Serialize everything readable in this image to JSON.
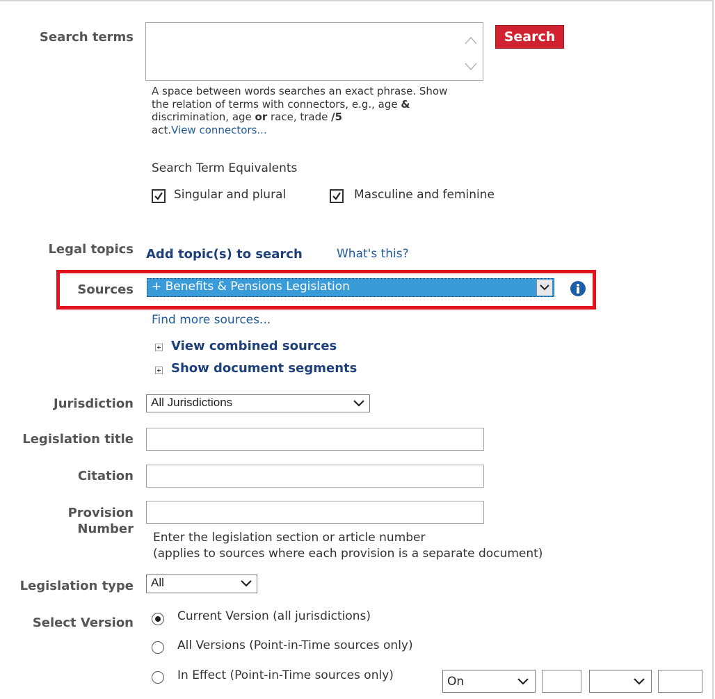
{
  "search_terms": {
    "label": "Search terms",
    "value": "",
    "search_button": "Search",
    "help_line1": "A space between words searches an exact phrase. Show",
    "help_line2a": "the relation of terms with connectors, e.g., age ",
    "help_and": "&",
    "help_line3a": "discrimination, age ",
    "help_or": "or",
    "help_line3b": " race, trade ",
    "help_w5": "/5",
    "help_line4": "act.",
    "view_connectors": "View connectors...",
    "equivalents_heading": "Search Term Equivalents",
    "singular_plural": "Singular and plural",
    "singular_plural_checked": true,
    "masculine_feminine": "Masculine and feminine",
    "masculine_feminine_checked": true
  },
  "legal_topics": {
    "label": "Legal topics",
    "add_topics": "Add topic(s) to search",
    "whats_this": "What's this?"
  },
  "sources": {
    "label": "Sources",
    "selected": "+  Benefits & Pensions Legislation",
    "find_more": "Find more sources...",
    "view_combined": "View combined sources",
    "show_segments": "Show document segments",
    "highlight_color": "#e0141e",
    "selected_bg": "#3a9bd9"
  },
  "jurisdiction": {
    "label": "Jurisdiction",
    "selected": "All Jurisdictions"
  },
  "legislation_title": {
    "label": "Legislation title",
    "value": ""
  },
  "citation": {
    "label": "Citation",
    "value": ""
  },
  "provision": {
    "label_line1": "Provision",
    "label_line2": "Number",
    "value": "",
    "help_line1": "Enter the legislation section or article number",
    "help_line2": "(applies to sources where each provision is a separate document)"
  },
  "legislation_type": {
    "label": "Legislation type",
    "selected": "All"
  },
  "select_version": {
    "label": "Select Version",
    "options": [
      {
        "label": "Current Version (all jurisdictions)",
        "selected": true
      },
      {
        "label": "All Versions (Point-in-Time sources only)",
        "selected": false
      },
      {
        "label": "In Effect (Point-in-Time sources only)",
        "selected": false
      }
    ],
    "in_effect_select": "On"
  }
}
